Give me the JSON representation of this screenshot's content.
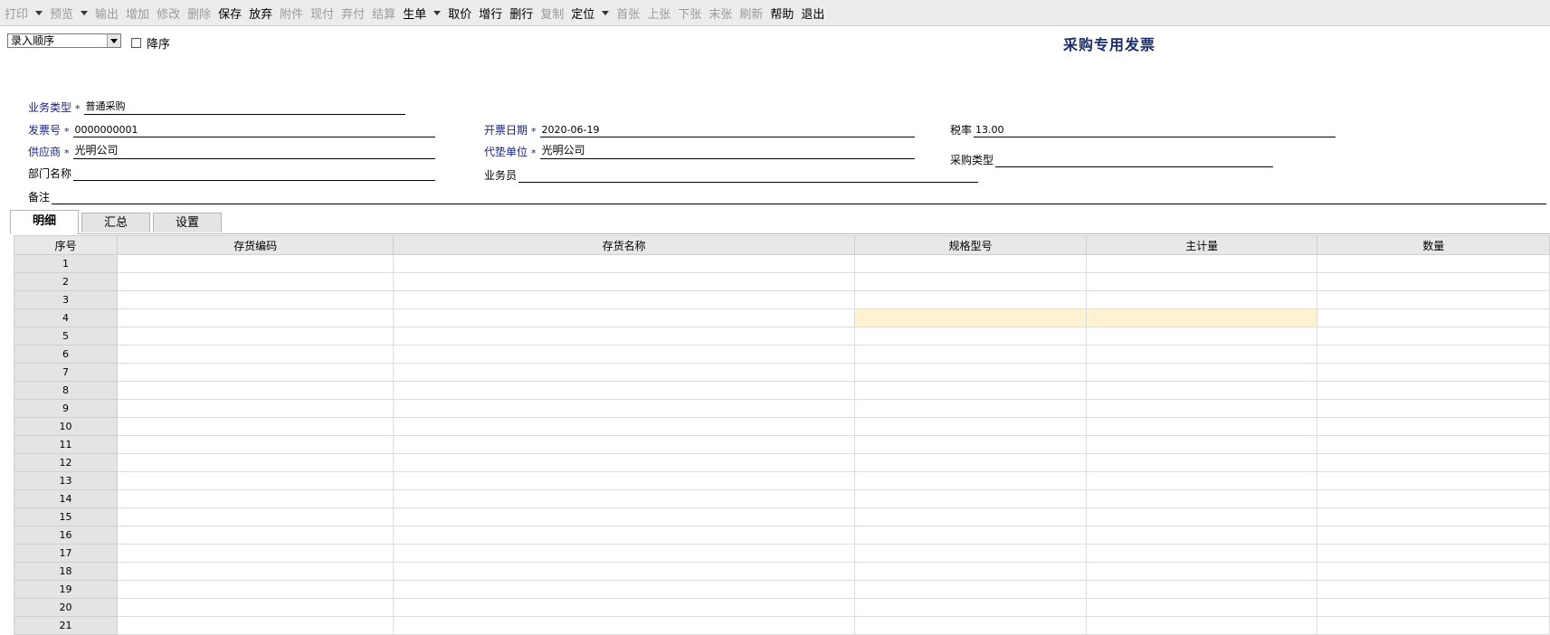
{
  "toolbar": {
    "buttons": [
      {
        "label": "打印",
        "enabled": false,
        "dropdown": true
      },
      {
        "label": "预览",
        "enabled": false,
        "dropdown": true
      },
      {
        "label": "输出",
        "enabled": false,
        "dropdown": false
      },
      {
        "label": "增加",
        "enabled": false,
        "dropdown": false
      },
      {
        "label": "修改",
        "enabled": false,
        "dropdown": false
      },
      {
        "label": "删除",
        "enabled": false,
        "dropdown": false
      },
      {
        "label": "保存",
        "enabled": true,
        "dropdown": false
      },
      {
        "label": "放弃",
        "enabled": true,
        "dropdown": false
      },
      {
        "label": "附件",
        "enabled": false,
        "dropdown": false
      },
      {
        "label": "现付",
        "enabled": false,
        "dropdown": false
      },
      {
        "label": "弃付",
        "enabled": false,
        "dropdown": false
      },
      {
        "label": "结算",
        "enabled": false,
        "dropdown": false
      },
      {
        "label": "生单",
        "enabled": true,
        "dropdown": true
      },
      {
        "label": "取价",
        "enabled": true,
        "dropdown": false
      },
      {
        "label": "增行",
        "enabled": true,
        "dropdown": false
      },
      {
        "label": "删行",
        "enabled": true,
        "dropdown": false
      },
      {
        "label": "复制",
        "enabled": false,
        "dropdown": false
      },
      {
        "label": "定位",
        "enabled": true,
        "dropdown": true
      },
      {
        "label": "首张",
        "enabled": false,
        "dropdown": false
      },
      {
        "label": "上张",
        "enabled": false,
        "dropdown": false
      },
      {
        "label": "下张",
        "enabled": false,
        "dropdown": false
      },
      {
        "label": "末张",
        "enabled": false,
        "dropdown": false
      },
      {
        "label": "刷新",
        "enabled": false,
        "dropdown": false
      },
      {
        "label": "帮助",
        "enabled": true,
        "dropdown": false
      },
      {
        "label": "退出",
        "enabled": true,
        "dropdown": false
      }
    ]
  },
  "sort": {
    "selected": "录入顺序",
    "descending_label": "降序",
    "descending_checked": false
  },
  "title": "采购专用发票",
  "form": {
    "business_type": {
      "label": "业务类型",
      "value": "普通采购",
      "required": true
    },
    "invoice_no": {
      "label": "发票号",
      "value": "0000000001",
      "required": true
    },
    "invoice_date": {
      "label": "开票日期",
      "value": "2020-06-19",
      "required": true
    },
    "tax_rate": {
      "label": "税率",
      "value": "13.00"
    },
    "supplier": {
      "label": "供应商",
      "value": "光明公司",
      "required": true
    },
    "agent_unit": {
      "label": "代垫单位",
      "value": "光明公司",
      "required": true
    },
    "purchase_type": {
      "label": "采购类型",
      "value": ""
    },
    "department": {
      "label": "部门名称",
      "value": ""
    },
    "salesman": {
      "label": "业务员",
      "value": ""
    },
    "remark": {
      "label": "备注",
      "value": ""
    }
  },
  "tabs": [
    {
      "label": "明细",
      "active": true
    },
    {
      "label": "汇总",
      "active": false
    },
    {
      "label": "设置",
      "active": false
    }
  ],
  "grid": {
    "columns": [
      "序号",
      "存货编码",
      "存货名称",
      "规格型号",
      "主计量",
      "数量"
    ],
    "rows": [
      "1",
      "2",
      "3",
      "4",
      "5",
      "6",
      "7",
      "8",
      "9",
      "10",
      "11",
      "12",
      "13",
      "14",
      "15",
      "16",
      "17",
      "18",
      "19",
      "20",
      "21"
    ],
    "highlight_row": "4"
  }
}
